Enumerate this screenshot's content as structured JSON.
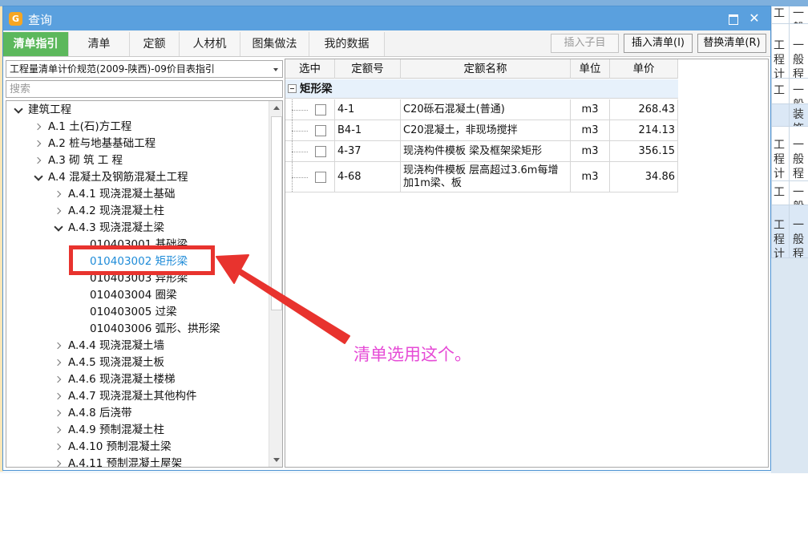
{
  "dialog": {
    "title": "查询",
    "icon": "app-logo-icon",
    "maximize_icon": "maximize-icon",
    "close_glyph": "✕"
  },
  "tabs": [
    {
      "label": "清单指引",
      "active": true
    },
    {
      "label": "清单",
      "active": false
    },
    {
      "label": "定额",
      "active": false
    },
    {
      "label": "人材机",
      "active": false
    },
    {
      "label": "图集做法",
      "active": false
    },
    {
      "label": "我的数据",
      "active": false
    }
  ],
  "toolbar": {
    "insert_child": "插入子目",
    "insert_list": "插入清单(I)",
    "replace_list": "替换清单(R)"
  },
  "left": {
    "spec_select": "工程量清单计价规范(2009-陕西)-09价目表指引",
    "search_placeholder": "搜索"
  },
  "tree": [
    {
      "label": "建筑工程",
      "level": 0,
      "state": "expanded"
    },
    {
      "label": "A.1  土(石)方工程",
      "level": 1,
      "state": "collapsed"
    },
    {
      "label": "A.2  桩与地基基础工程",
      "level": 1,
      "state": "collapsed"
    },
    {
      "label": "A.3  砌 筑 工 程",
      "level": 1,
      "state": "collapsed"
    },
    {
      "label": "A.4  混凝土及钢筋混凝土工程",
      "level": 1,
      "state": "expanded"
    },
    {
      "label": "A.4.1  现浇混凝土基础",
      "level": 2,
      "state": "collapsed"
    },
    {
      "label": "A.4.2  现浇混凝土柱",
      "level": 2,
      "state": "collapsed"
    },
    {
      "label": "A.4.3  现浇混凝土梁",
      "level": 2,
      "state": "expanded"
    },
    {
      "label": "010403001  基础梁",
      "level": 3,
      "state": "leaf"
    },
    {
      "label": "010403002  矩形梁",
      "level": 3,
      "state": "leaf",
      "selected": true
    },
    {
      "label": "010403003  异形梁",
      "level": 3,
      "state": "leaf"
    },
    {
      "label": "010403004  圈梁",
      "level": 3,
      "state": "leaf"
    },
    {
      "label": "010403005  过梁",
      "level": 3,
      "state": "leaf"
    },
    {
      "label": "010403006  弧形、拱形梁",
      "level": 3,
      "state": "leaf"
    },
    {
      "label": "A.4.4  现浇混凝土墙",
      "level": 2,
      "state": "collapsed"
    },
    {
      "label": "A.4.5  现浇混凝土板",
      "level": 2,
      "state": "collapsed"
    },
    {
      "label": "A.4.6  现浇混凝土楼梯",
      "level": 2,
      "state": "collapsed"
    },
    {
      "label": "A.4.7  现浇混凝土其他构件",
      "level": 2,
      "state": "collapsed"
    },
    {
      "label": "A.4.8  后浇带",
      "level": 2,
      "state": "collapsed"
    },
    {
      "label": "A.4.9  预制混凝土柱",
      "level": 2,
      "state": "collapsed"
    },
    {
      "label": "A.4.10  预制混凝土梁",
      "level": 2,
      "state": "collapsed"
    },
    {
      "label": "A.4.11  预制混凝土屋架",
      "level": 2,
      "state": "collapsed"
    }
  ],
  "grid": {
    "headers": [
      "选中",
      "定额号",
      "定额名称",
      "单位",
      "单价"
    ],
    "group_label": "矩形梁",
    "rows": [
      {
        "code": "4-1",
        "name": "C20砾石混凝土(普通)",
        "unit": "m3",
        "price": "268.43"
      },
      {
        "code": "B4-1",
        "name": "C20混凝土，非现场搅拌",
        "unit": "m3",
        "price": "214.13"
      },
      {
        "code": "4-37",
        "name": "现浇构件模板 梁及框架梁矩形",
        "unit": "m3",
        "price": "356.15"
      },
      {
        "code": "4-68",
        "name": "现浇构件模板 层高超过3.6m每增加1m梁、板",
        "unit": "m3",
        "price": "34.86"
      }
    ]
  },
  "annotation": {
    "text": "清单选用这个。",
    "color": "#e64bd6",
    "box_color": "#e8332e"
  },
  "background": {
    "right_rows": [
      {
        "c1": "工",
        "c2": "一般"
      },
      {
        "c1": "工程计",
        "c2": "一般程"
      },
      {
        "c1": "工",
        "c2": "一般"
      },
      {
        "c1": "",
        "c2": "装饰"
      },
      {
        "c1": "工程计",
        "c2": "一般程"
      },
      {
        "c1": "工",
        "c2": "一般"
      },
      {
        "c1": "工程计",
        "c2": "一般程"
      }
    ]
  }
}
